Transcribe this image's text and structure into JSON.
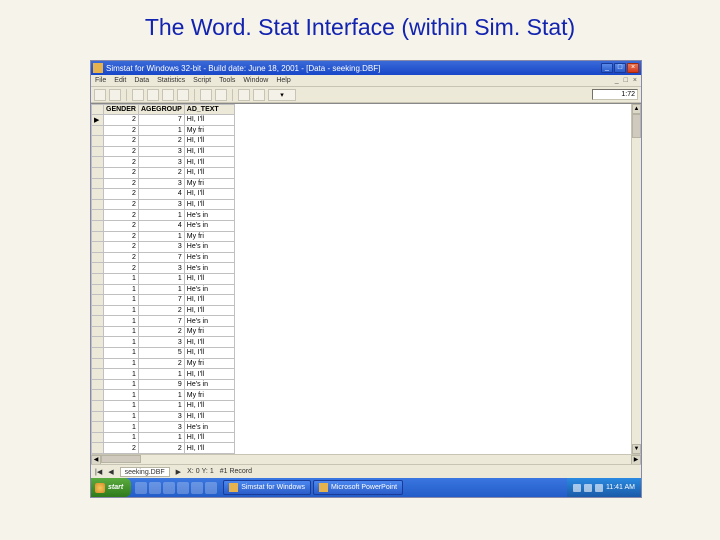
{
  "slide_title": "The Word. Stat Interface (within Sim. Stat)",
  "titlebar": {
    "text": "Simstat for Windows 32-bit - Build date: June 18, 2001 - [Data - seeking.DBF]"
  },
  "window_controls": {
    "min": "_",
    "max": "□",
    "close": "×"
  },
  "menu": [
    "File",
    "Edit",
    "Data",
    "Statistics",
    "Script",
    "Tools",
    "Window",
    "Help"
  ],
  "doc_controls": [
    "_",
    "□",
    "×"
  ],
  "record_counter": "1:72",
  "columns": [
    "GENDER",
    "AGEGROUP",
    "AD_TEXT"
  ],
  "rows": [
    {
      "gender": "2",
      "age": "7",
      "txt": "HI, I'll"
    },
    {
      "gender": "2",
      "age": "1",
      "txt": "My fri"
    },
    {
      "gender": "2",
      "age": "2",
      "txt": "HI, I'll"
    },
    {
      "gender": "2",
      "age": "3",
      "txt": "HI, I'll"
    },
    {
      "gender": "2",
      "age": "3",
      "txt": "HI, I'll"
    },
    {
      "gender": "2",
      "age": "2",
      "txt": "HI, I'll"
    },
    {
      "gender": "2",
      "age": "3",
      "txt": "My fri"
    },
    {
      "gender": "2",
      "age": "4",
      "txt": "HI, I'll"
    },
    {
      "gender": "2",
      "age": "3",
      "txt": "HI, I'll"
    },
    {
      "gender": "2",
      "age": "1",
      "txt": "He's in"
    },
    {
      "gender": "2",
      "age": "4",
      "txt": "He's in"
    },
    {
      "gender": "2",
      "age": "1",
      "txt": "My fri"
    },
    {
      "gender": "2",
      "age": "3",
      "txt": "He's in"
    },
    {
      "gender": "2",
      "age": "7",
      "txt": "He's in"
    },
    {
      "gender": "2",
      "age": "3",
      "txt": "He's in"
    },
    {
      "gender": "1",
      "age": "1",
      "txt": "HI, I'll"
    },
    {
      "gender": "1",
      "age": "1",
      "txt": "He's in"
    },
    {
      "gender": "1",
      "age": "7",
      "txt": "HI, I'll"
    },
    {
      "gender": "1",
      "age": "2",
      "txt": "HI, I'll"
    },
    {
      "gender": "1",
      "age": "7",
      "txt": "He's in"
    },
    {
      "gender": "1",
      "age": "2",
      "txt": "My fri"
    },
    {
      "gender": "1",
      "age": "3",
      "txt": "HI, I'll"
    },
    {
      "gender": "1",
      "age": "5",
      "txt": "HI, I'll"
    },
    {
      "gender": "1",
      "age": "2",
      "txt": "My fri"
    },
    {
      "gender": "1",
      "age": "1",
      "txt": "HI, I'll"
    },
    {
      "gender": "1",
      "age": "9",
      "txt": "He's in"
    },
    {
      "gender": "1",
      "age": "1",
      "txt": "My fri"
    },
    {
      "gender": "1",
      "age": "1",
      "txt": "HI, I'll"
    },
    {
      "gender": "1",
      "age": "3",
      "txt": "HI, I'll"
    },
    {
      "gender": "1",
      "age": "3",
      "txt": "He's in"
    },
    {
      "gender": "1",
      "age": "1",
      "txt": "HI, I'll"
    },
    {
      "gender": "2",
      "age": "2",
      "txt": "HI, I'll"
    }
  ],
  "sheet_tab": "seeking.DBF",
  "nav": {
    "x_label": "X:",
    "x_val": "0",
    "y_label": "Y:",
    "y_val": "1",
    "record_label": "#1 Record"
  },
  "taskbar": {
    "start": "start",
    "tasks": [
      "Simstat for Windows",
      "Microsoft PowerPoint"
    ],
    "clock": "11:41 AM"
  }
}
